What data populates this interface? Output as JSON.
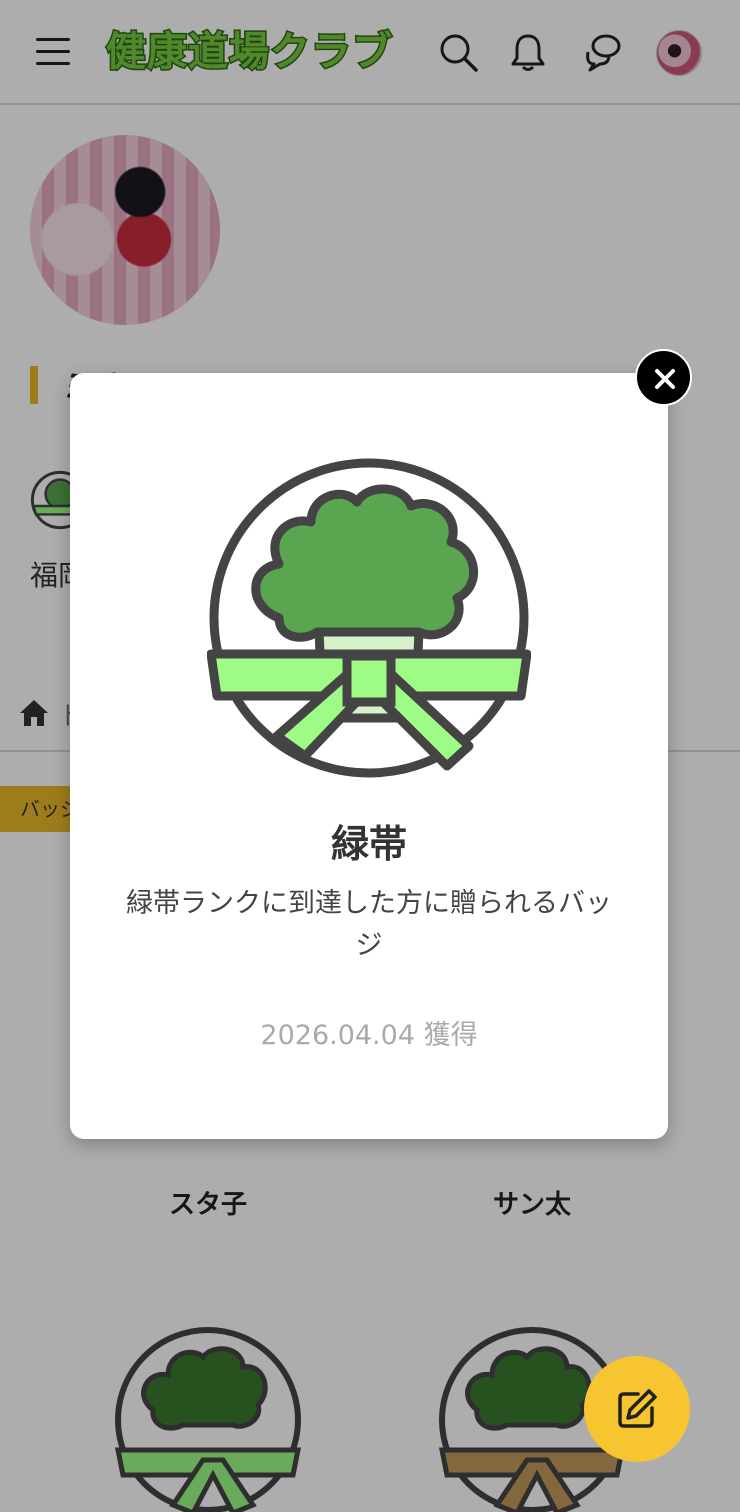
{
  "header": {
    "logo_text": "健康道場クラブ",
    "icons": [
      "menu-icon",
      "search-icon",
      "bell-icon",
      "chat-icon",
      "avatar"
    ]
  },
  "profile": {
    "name": "ミキ",
    "location_prefix": "福岡",
    "breadcrumb_prefix": "ト"
  },
  "tabs": {
    "active_tag": "バッジ"
  },
  "friends": [
    {
      "name": "スタ子"
    },
    {
      "name": "サン太"
    }
  ],
  "modal": {
    "title": "緑帯",
    "description": "緑帯ランクに到達した方に贈られるバッジ",
    "acquired_date": "2026.04.04 獲得",
    "close_icon": "close-icon"
  },
  "colors": {
    "accent_yellow": "#f7c52f",
    "tag_yellow": "#e8b928",
    "belt_green": "#9dfb86",
    "broccoli_green": "#5aa54f",
    "belt_tan": "#c39a5a",
    "logo_green": "#7ac943"
  }
}
